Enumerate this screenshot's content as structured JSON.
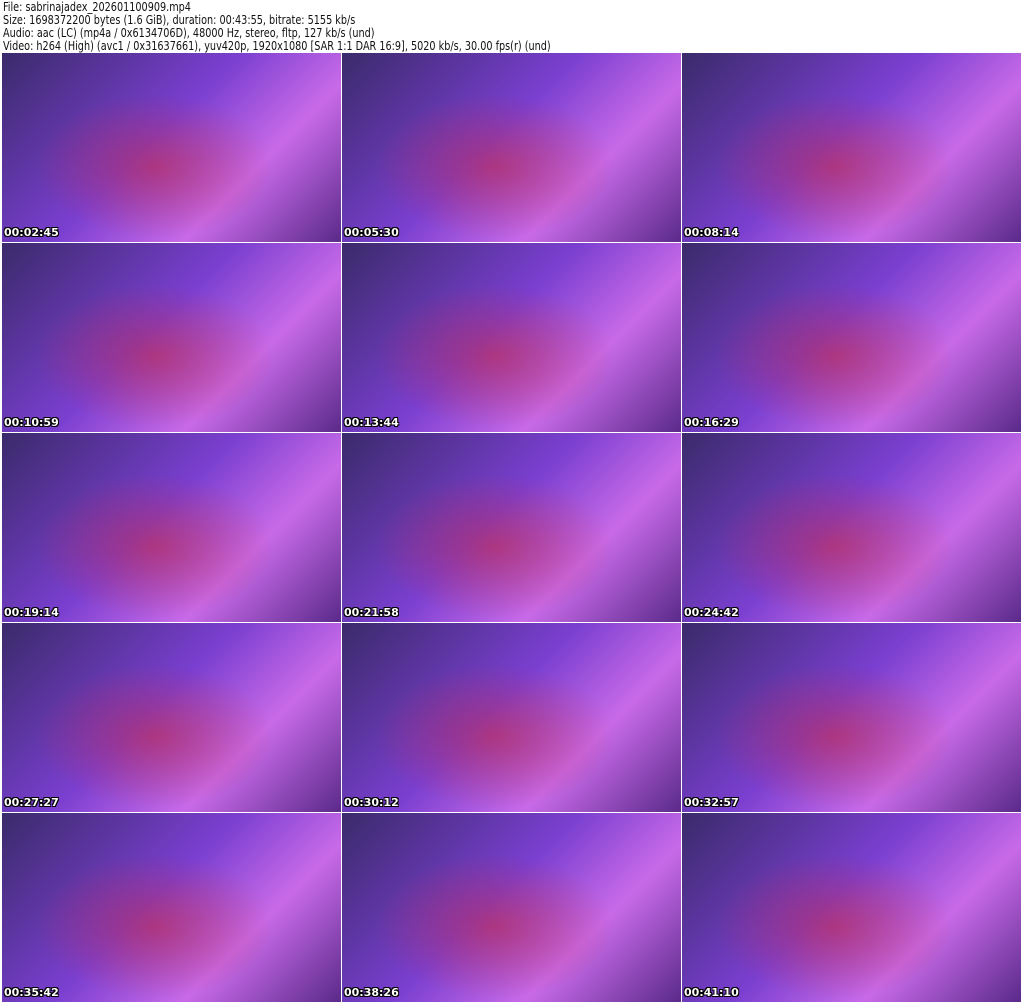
{
  "header": {
    "file": "File: sabrinajadex_202601100909.mp4",
    "size": "Size: 1698372200 bytes (1.6 GiB), duration: 00:43:55, bitrate: 5155 kb/s",
    "audio": "Audio: aac (LC) (mp4a / 0x6134706D), 48000 Hz, stereo, fltp, 127 kb/s (und)",
    "video": "Video: h264 (High) (avc1 / 0x31637661), yuv420p, 1920x1080 [SAR 1:1 DAR 16:9], 5020 kb/s, 30.00 fps(r) (und)"
  },
  "thumbnails": [
    {
      "timestamp": "00:02:45"
    },
    {
      "timestamp": "00:05:30"
    },
    {
      "timestamp": "00:08:14"
    },
    {
      "timestamp": "00:10:59"
    },
    {
      "timestamp": "00:13:44"
    },
    {
      "timestamp": "00:16:29"
    },
    {
      "timestamp": "00:19:14"
    },
    {
      "timestamp": "00:21:58"
    },
    {
      "timestamp": "00:24:42"
    },
    {
      "timestamp": "00:27:27"
    },
    {
      "timestamp": "00:30:12"
    },
    {
      "timestamp": "00:32:57"
    },
    {
      "timestamp": "00:35:42"
    },
    {
      "timestamp": "00:38:26"
    },
    {
      "timestamp": "00:41:10"
    }
  ]
}
